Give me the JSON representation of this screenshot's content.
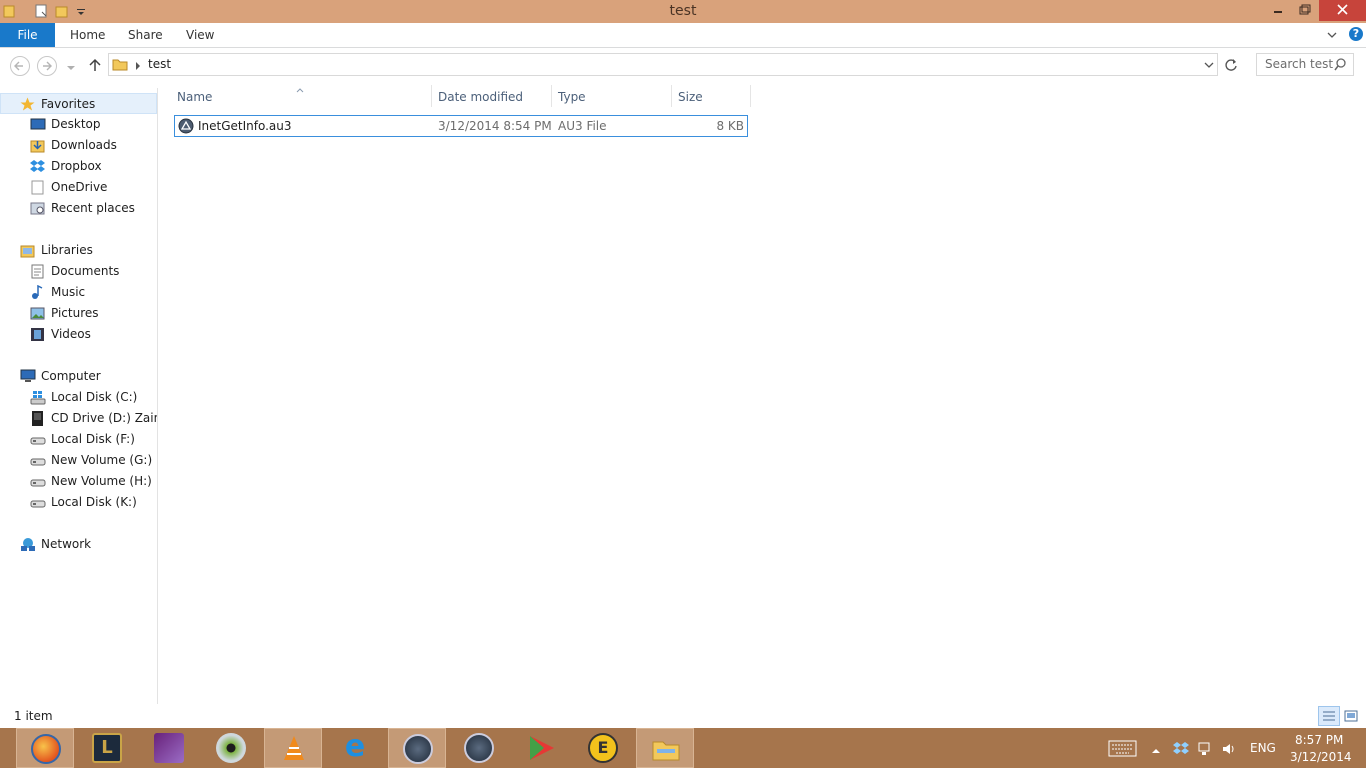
{
  "window": {
    "title": "test"
  },
  "ribbon": {
    "tabs": [
      "File",
      "Home",
      "Share",
      "View"
    ],
    "help": "?"
  },
  "address": {
    "path": "test",
    "search_placeholder": "Search test"
  },
  "sidebar": {
    "favorites": {
      "label": "Favorites",
      "items": [
        "Desktop",
        "Downloads",
        "Dropbox",
        "OneDrive",
        "Recent places"
      ]
    },
    "libraries": {
      "label": "Libraries",
      "items": [
        "Documents",
        "Music",
        "Pictures",
        "Videos"
      ]
    },
    "computer": {
      "label": "Computer",
      "items": [
        "Local Disk (C:)",
        "CD Drive (D:) Zain Broadband",
        "Local Disk (F:)",
        "New Volume (G:)",
        "New Volume (H:)",
        "Local Disk (K:)"
      ]
    },
    "network": {
      "label": "Network"
    }
  },
  "columns": {
    "name": "Name",
    "date": "Date modified",
    "type": "Type",
    "size": "Size"
  },
  "files": [
    {
      "name": "InetGetInfo.au3",
      "date": "3/12/2014 8:54 PM",
      "type": "AU3 File",
      "size": "8 KB"
    }
  ],
  "status": {
    "count": "1 item"
  },
  "taskbar": {
    "apps": [
      "Firefox",
      "League of Legends",
      "Visual Studio",
      "Eye app",
      "VLC media player",
      "Internet Explorer",
      "AutoIt",
      "AutoIt",
      "Media player",
      "UltraEdit",
      "File Explorer"
    ],
    "language": "ENG",
    "time": "8:57 PM",
    "date": "3/12/2014"
  },
  "colors": {
    "titlebar": "#d9a27b",
    "taskbar": "#a6754c",
    "accent": "#1979ca",
    "close": "#c7443b",
    "selection_border": "#3a8fdd"
  }
}
